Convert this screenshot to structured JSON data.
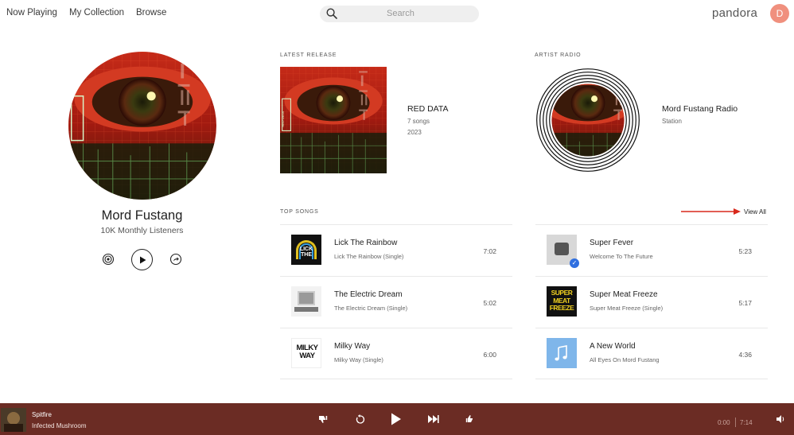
{
  "header": {
    "nav": [
      "Now Playing",
      "My Collection",
      "Browse"
    ],
    "search_placeholder": "Search",
    "logo": "pandora",
    "avatar_initial": "D"
  },
  "artist": {
    "name": "Mord Fustang",
    "listeners": "10K Monthly Listeners"
  },
  "latest_release": {
    "label": "LATEST RELEASE",
    "title": "RED DATA",
    "songs": "7 songs",
    "year": "2023"
  },
  "artist_radio": {
    "label": "ARTIST RADIO",
    "title": "Mord Fustang Radio",
    "sub": "Station"
  },
  "top_songs": {
    "label": "TOP SONGS",
    "view_all": "View All",
    "songs": [
      {
        "title": "Lick The Rainbow",
        "album": "Lick The Rainbow (Single)",
        "duration": "7:02"
      },
      {
        "title": "The Electric Dream",
        "album": "The Electric Dream (Single)",
        "duration": "5:02"
      },
      {
        "title": "Milky Way",
        "album": "Milky Way (Single)",
        "duration": "6:00"
      },
      {
        "title": "Super Fever",
        "album": "Welcome To The Future",
        "duration": "5:23"
      },
      {
        "title": "Super Meat Freeze",
        "album": "Super Meat Freeze (Single)",
        "duration": "5:17"
      },
      {
        "title": "A New World",
        "album": "All Eyes On Mord Fustang",
        "duration": "4:36"
      }
    ]
  },
  "player": {
    "title": "Spitfire",
    "artist": "Infected Mushroom",
    "elapsed": "0:00",
    "total": "7:14"
  },
  "art_text": {
    "red_data_side": "RED DATA",
    "milky_way": [
      "MILKY",
      "WAY"
    ],
    "lick_the": [
      "LICK",
      "THE"
    ],
    "super_meat": [
      "SUPER",
      "MEAT",
      "FREEZE"
    ]
  },
  "colors": {
    "player_bg": "#6b2c24",
    "avatar": "#f0907e",
    "accent_red": "#d8281c"
  }
}
